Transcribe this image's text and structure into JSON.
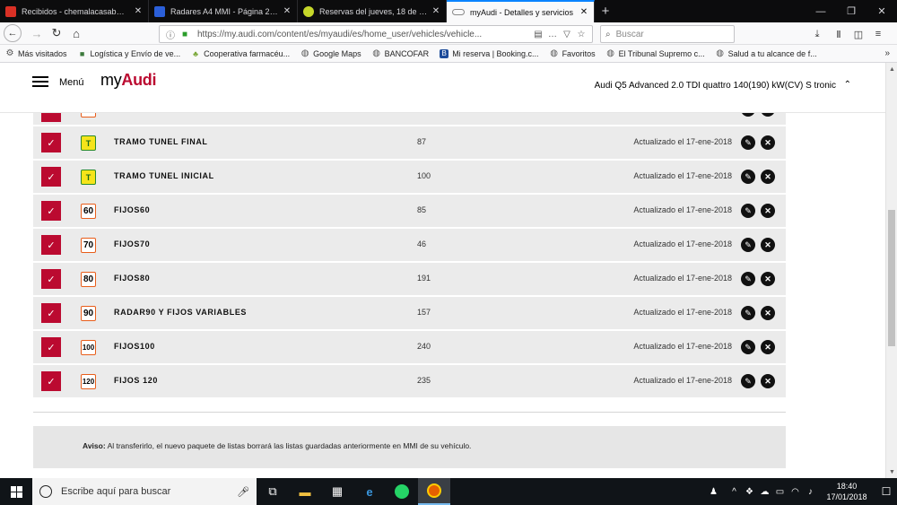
{
  "browser": {
    "tabs": [
      {
        "title": "Recibidos - chemalacasab@gm",
        "favicon_color": "#d93025",
        "close": "✕",
        "active": false
      },
      {
        "title": "Radares A4 MMI - Página 22 - l",
        "favicon_color": "#2b5fd9",
        "close": "✕",
        "active": false
      },
      {
        "title": "Reservas del jueves, 18 de ener",
        "favicon_color": "#c6d72a",
        "close": "✕",
        "active": false
      },
      {
        "title": "myAudi - Detalles y servicios",
        "favicon_color": "#888888",
        "close": "✕",
        "active": true
      }
    ],
    "new_tab_symbol": "+",
    "window_controls": {
      "minimize": "—",
      "maximize": "❐",
      "close": "✕"
    },
    "url": "https://my.audi.com/content/es/myaudi/es/home_user/vehicles/vehicle...",
    "search_placeholder": "Buscar",
    "bookmarks": [
      {
        "label": "Más visitados",
        "color": "#555555"
      },
      {
        "label": "Logística y Envío de ve...",
        "color": "#3d7a3d"
      },
      {
        "label": "Cooperativa farmacéu...",
        "color": "#7aa83a"
      },
      {
        "label": "Google Maps",
        "color": "#555555"
      },
      {
        "label": "BANCOFAR",
        "color": "#555555"
      },
      {
        "label": "Mi reserva | Booking.c...",
        "color": "#1d4c9a"
      },
      {
        "label": "Favoritos",
        "color": "#555555"
      },
      {
        "label": "El Tribunal Supremo c...",
        "color": "#555555"
      },
      {
        "label": "Salud a tu alcance de f...",
        "color": "#555555"
      }
    ],
    "bookmarks_overflow": "»"
  },
  "header": {
    "menu_label": "Menú",
    "logo_prefix": "my",
    "logo_suffix": "Audi",
    "vehicle": "Audi Q5 Advanced 2.0 TDI quattro 140(190) kW(CV) S tronic",
    "chevron": "⌃"
  },
  "list": {
    "rows": [
      {
        "sign": "T",
        "sign_type": "tunnel",
        "name": "TRAMO TUNEL FINAL",
        "count": "87",
        "updated": "Actualizado el 17-ene-2018"
      },
      {
        "sign": "T",
        "sign_type": "tunnel",
        "name": "TRAMO TUNEL INICIAL",
        "count": "100",
        "updated": "Actualizado el 17-ene-2018"
      },
      {
        "sign": "60",
        "sign_type": "speed",
        "name": "FIJOS60",
        "count": "85",
        "updated": "Actualizado el 17-ene-2018"
      },
      {
        "sign": "70",
        "sign_type": "speed",
        "name": "FIJOS70",
        "count": "46",
        "updated": "Actualizado el 17-ene-2018"
      },
      {
        "sign": "80",
        "sign_type": "speed",
        "name": "FIJOS80",
        "count": "191",
        "updated": "Actualizado el 17-ene-2018"
      },
      {
        "sign": "90",
        "sign_type": "speed",
        "name": "RADAR90 Y FIJOS VARIABLES",
        "count": "157",
        "updated": "Actualizado el 17-ene-2018"
      },
      {
        "sign": "100",
        "sign_type": "speed",
        "name": "FIJOS100",
        "count": "240",
        "updated": "Actualizado el 17-ene-2018"
      },
      {
        "sign": "120",
        "sign_type": "speed",
        "name": "FIJOS 120",
        "count": "235",
        "updated": "Actualizado el 17-ene-2018"
      }
    ],
    "check_symbol": "✓",
    "edit_symbol": "✎",
    "delete_symbol": "✕"
  },
  "notice": {
    "label": "Aviso:",
    "text": " Al transferirlo, el nuevo paquete de listas borrará las listas guardadas anteriormente en MMI de su vehículo."
  },
  "taskbar": {
    "search_placeholder": "Escribe aquí para buscar",
    "time": "18:40",
    "date": "17/01/2018"
  }
}
